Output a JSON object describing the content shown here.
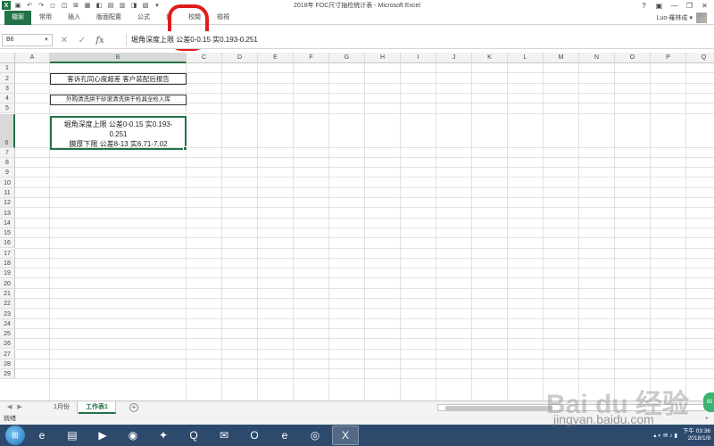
{
  "window": {
    "title": "2018年 FOC尺寸抽检统计表 - Microsoft Excel"
  },
  "qat": {
    "app_icon": "X",
    "save_icon": "▣",
    "undo_icon": "↶",
    "redo_icon": "↷",
    "more_icon": "▾"
  },
  "window_controls": [
    "?",
    "▣",
    "—",
    "❐",
    "✕"
  ],
  "ribbon": {
    "tabs": [
      "檔案",
      "常用",
      "插入",
      "版面配置",
      "公式",
      "資",
      "校閱",
      "檢視"
    ],
    "account_name": "Luo-羅林成 ▾"
  },
  "formula_bar": {
    "name_box": "B6",
    "cancel_icon": "✕",
    "enter_icon": "✓",
    "fx_label": "fx",
    "content": "堀角深度上限 公差0-0.15  实0.193-0.251"
  },
  "grid": {
    "columns": [
      "A",
      "B",
      "C",
      "D",
      "E",
      "F",
      "G",
      "H",
      "I",
      "J",
      "K",
      "L",
      "M",
      "N",
      "O",
      "P",
      "Q"
    ],
    "rows": [
      "1",
      "2",
      "3",
      "4",
      "5",
      "6",
      "7",
      "8",
      "9",
      "10",
      "11",
      "12",
      "13",
      "14",
      "15",
      "16",
      "17",
      "18",
      "19",
      "20",
      "21",
      "22",
      "23",
      "24",
      "25",
      "26",
      "27",
      "28",
      "29"
    ],
    "selected_column": "B",
    "selected_row": "6"
  },
  "cells": {
    "b2": "客诉孔同心度超差 客户装配后报告",
    "b4": "外购清洗烘干砂滚清洗烘干检具全检入库",
    "b6_line1": "堀角深度上限 公差0-0.15  实0.193-",
    "b6_line2": "0.251",
    "b6_line3": "膜厚下限 公差8-13  实6.71-7.02"
  },
  "sheets": {
    "nav_prev": "◀",
    "nav_next": "▶",
    "tabs": [
      "1月份",
      "工作表1"
    ],
    "active": "工作表1",
    "add_icon": "+"
  },
  "status": {
    "ready": "就绪",
    "zoom": "+"
  },
  "taskbar": {
    "apps": [
      "e",
      "▤",
      "▶",
      "◉",
      "✦",
      "Q",
      "✉",
      "O",
      "e",
      "◎",
      "X"
    ],
    "time": "下午 03:36",
    "date": "2018/1/9"
  },
  "watermark": {
    "logo": "Bai du 经验",
    "url": "jingyan.baidu.com"
  },
  "side_badge": "85"
}
